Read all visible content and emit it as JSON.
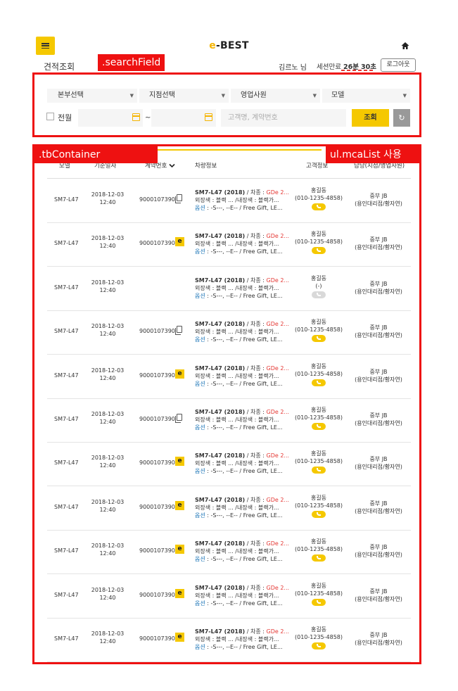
{
  "header": {
    "logo_e": "e",
    "logo_rest": "-BEST",
    "page_title": "견적조회",
    "user_name": "김르노 님",
    "session_label": "세션만료",
    "session_min": "26분",
    "session_sec": "30초",
    "logout_label": "로그아웃"
  },
  "annotations": {
    "search_field": ".searchField",
    "tb_container": ".tbContainer",
    "mca_list": "ul.mcaList 사용"
  },
  "search": {
    "selects": [
      "본부선택",
      "지점선택",
      "영업사원",
      "모델"
    ],
    "all_month_label": "전월",
    "date_sep": "~",
    "keyword_placeholder": "고객명, 계약번호",
    "search_label": "조회"
  },
  "table": {
    "headers": {
      "model": "모델",
      "date": "기준일자",
      "contract": "계약번호",
      "car": "차량정보",
      "customer": "고객정보",
      "charge": "담당(지점/영업사원)"
    },
    "rows": [
      {
        "model": "SM7-L47",
        "date": "2018-12-03",
        "time": "12:40",
        "contract": "9000107390",
        "mark": "copy",
        "car_title": "SM7-L47 (2018)",
        "car_grade_label": " / 차종 : ",
        "car_grade": "GDe 2...",
        "car_color": "외장색 : 블랙 ...  /내장색 : 블랙가...",
        "option_label": "옵션",
        "option_text": " : -S---, --E-- / Free Gift, LE...",
        "cust_name": "홍길동",
        "cust_phone": "(010-1235-4858)",
        "phone_active": true,
        "charge_1": "중부 JB",
        "charge_2": "(용인대리점/황자연)"
      },
      {
        "model": "SM7-L47",
        "date": "2018-12-03",
        "time": "12:40",
        "contract": "9000107390",
        "mark": "e",
        "car_title": "SM7-L47 (2018)",
        "car_grade_label": " / 차종 : ",
        "car_grade": "GDe 2...",
        "car_color": "외장색 : 블랙 ...  /내장색 : 블랙가...",
        "option_label": "옵션",
        "option_text": " : -S---, --E-- / Free Gift, LE...",
        "cust_name": "홍길동",
        "cust_phone": "(010-1235-4858)",
        "phone_active": true,
        "charge_1": "중부 JB",
        "charge_2": "(용인대리점/황자연)"
      },
      {
        "model": "SM7-L47",
        "date": "2018-12-03",
        "time": "12:40",
        "contract": "",
        "mark": "none",
        "car_title": "SM7-L47 (2018)",
        "car_grade_label": " / 차종 : ",
        "car_grade": "GDe 2...",
        "car_color": "외장색 : 블랙 ...  /내장색 : 블랙가...",
        "option_label": "옵션",
        "option_text": " : -S---, --E-- / Free Gift, LE...",
        "cust_name": "홍길동",
        "cust_phone": "(-)",
        "phone_active": false,
        "charge_1": "중부 JB",
        "charge_2": "(용인대리점/황자연)"
      },
      {
        "model": "SM7-L47",
        "date": "2018-12-03",
        "time": "12:40",
        "contract": "9000107390",
        "mark": "copy",
        "car_title": "SM7-L47 (2018)",
        "car_grade_label": " / 차종 : ",
        "car_grade": "GDe 2...",
        "car_color": "외장색 : 블랙 ...  /내장색 : 블랙가...",
        "option_label": "옵션",
        "option_text": " : -S---, --E-- / Free Gift, LE...",
        "cust_name": "홍길동",
        "cust_phone": "(010-1235-4858)",
        "phone_active": true,
        "charge_1": "중부 JB",
        "charge_2": "(용인대리점/황자연)"
      },
      {
        "model": "SM7-L47",
        "date": "2018-12-03",
        "time": "12:40",
        "contract": "9000107390",
        "mark": "e",
        "car_title": "SM7-L47 (2018)",
        "car_grade_label": " / 차종 : ",
        "car_grade": "GDe 2...",
        "car_color": "외장색 : 블랙 ...  /내장색 : 블랙가...",
        "option_label": "옵션",
        "option_text": " : -S---, --E-- / Free Gift, LE...",
        "cust_name": "홍길동",
        "cust_phone": "(010-1235-4858)",
        "phone_active": true,
        "charge_1": "중부 JB",
        "charge_2": "(용인대리점/황자연)"
      },
      {
        "model": "SM7-L47",
        "date": "2018-12-03",
        "time": "12:40",
        "contract": "9000107390",
        "mark": "copy",
        "car_title": "SM7-L47 (2018)",
        "car_grade_label": " / 차종 : ",
        "car_grade": "GDe 2...",
        "car_color": "외장색 : 블랙 ...  /내장색 : 블랙가...",
        "option_label": "옵션",
        "option_text": " : -S---, --E-- / Free Gift, LE...",
        "cust_name": "홍길동",
        "cust_phone": "(010-1235-4858)",
        "phone_active": true,
        "charge_1": "중부 JB",
        "charge_2": "(용인대리점/황자연)"
      },
      {
        "model": "SM7-L47",
        "date": "2018-12-03",
        "time": "12:40",
        "contract": "9000107390",
        "mark": "e",
        "car_title": "SM7-L47 (2018)",
        "car_grade_label": " / 차종 : ",
        "car_grade": "GDe 2...",
        "car_color": "외장색 : 블랙 ...  /내장색 : 블랙가...",
        "option_label": "옵션",
        "option_text": " : -S---, --E-- / Free Gift, LE...",
        "cust_name": "홍길동",
        "cust_phone": "(010-1235-4858)",
        "phone_active": true,
        "charge_1": "중부 JB",
        "charge_2": "(용인대리점/황자연)"
      },
      {
        "model": "SM7-L47",
        "date": "2018-12-03",
        "time": "12:40",
        "contract": "9000107390",
        "mark": "e",
        "car_title": "SM7-L47 (2018)",
        "car_grade_label": " / 차종 : ",
        "car_grade": "GDe 2...",
        "car_color": "외장색 : 블랙 ...  /내장색 : 블랙가...",
        "option_label": "옵션",
        "option_text": " : -S---, --E-- / Free Gift, LE...",
        "cust_name": "홍길동",
        "cust_phone": "(010-1235-4858)",
        "phone_active": true,
        "charge_1": "중부 JB",
        "charge_2": "(용인대리점/황자연)"
      },
      {
        "model": "SM7-L47",
        "date": "2018-12-03",
        "time": "12:40",
        "contract": "9000107390",
        "mark": "e",
        "car_title": "SM7-L47 (2018)",
        "car_grade_label": " / 차종 : ",
        "car_grade": "GDe 2...",
        "car_color": "외장색 : 블랙 ...  /내장색 : 블랙가...",
        "option_label": "옵션",
        "option_text": " : -S---, --E-- / Free Gift, LE...",
        "cust_name": "홍길동",
        "cust_phone": "(010-1235-4858)",
        "phone_active": true,
        "charge_1": "중부 JB",
        "charge_2": "(용인대리점/황자연)"
      },
      {
        "model": "SM7-L47",
        "date": "2018-12-03",
        "time": "12:40",
        "contract": "9000107390",
        "mark": "e",
        "car_title": "SM7-L47 (2018)",
        "car_grade_label": " / 차종 : ",
        "car_grade": "GDe 2...",
        "car_color": "외장색 : 블랙 ...  /내장색 : 블랙가...",
        "option_label": "옵션",
        "option_text": " : -S---, --E-- / Free Gift, LE...",
        "cust_name": "홍길동",
        "cust_phone": "(010-1235-4858)",
        "phone_active": true,
        "charge_1": "중부 JB",
        "charge_2": "(용인대리점/황자연)"
      },
      {
        "model": "SM7-L47",
        "date": "2018-12-03",
        "time": "12:40",
        "contract": "9000107390",
        "mark": "e",
        "car_title": "SM7-L47 (2018)",
        "car_grade_label": " / 차종 : ",
        "car_grade": "GDe 2...",
        "car_color": "외장색 : 블랙 ...  /내장색 : 블랙가...",
        "option_label": "옵션",
        "option_text": " : -S---, --E-- / Free Gift, LE...",
        "cust_name": "홍길동",
        "cust_phone": "(010-1235-4858)",
        "phone_active": true,
        "charge_1": "중부 JB",
        "charge_2": "(용인대리점/황자연)"
      }
    ]
  },
  "icons": {
    "menu": "hamburger-menu-icon",
    "home": "home-icon",
    "calendar": "calendar-icon",
    "refresh": "refresh-icon",
    "copy": "copy-icon",
    "e_badge": "e-badge-icon",
    "phone": "phone-icon",
    "sort": "chevron-down-icon"
  },
  "colors": {
    "accent": "#f5c800",
    "annotation_red": "#ee1111",
    "grade_red": "#e53935",
    "option_blue": "#1b74b7"
  }
}
